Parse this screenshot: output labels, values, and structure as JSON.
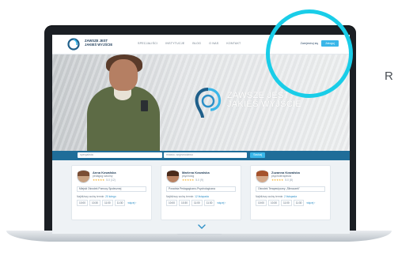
{
  "brand": {
    "name_line1": "ZAWSZE JEST",
    "name_line2": "JAKIEŚ WYJŚCIE",
    "accent": "#3ab6e8",
    "dark": "#1f6d99"
  },
  "nav": {
    "items": [
      "SPECJALIŚCI",
      "INSTYTUCJE",
      "BLOG",
      "O NAS",
      "KONTAKT"
    ],
    "login": "Zarejestruj się",
    "cta": "Zaloguj"
  },
  "hero": {
    "line1": "ZAWSZE JEST",
    "line2": "JAKIEŚ WYJŚCIE"
  },
  "search": {
    "specialist_placeholder": "specjalista",
    "location_placeholder": "miasto, województwo",
    "button": "Szukaj"
  },
  "cards": [
    {
      "name": "Anna Kowalska",
      "role": "pedagog szkolny",
      "stars": "★★★★★",
      "score": "5.0 (12)",
      "tag": "Miejski Ośrodek Pomocy Społecznej",
      "next_label": "Najbliższy wolny termin:",
      "next_date": "20 lutego",
      "slots": [
        "10:00",
        "10:30",
        "11:00",
        "11:30"
      ],
      "more": "więcej ›"
    },
    {
      "name": "Marlena Kowalska",
      "role": "psycholog",
      "stars": "★★★★★",
      "score": "5.0 (9)",
      "tag": "Poradnia Pedagogiczno-Psychologiczna",
      "next_label": "Najbliższy wolny termin:",
      "next_date": "12 listopada",
      "slots": [
        "10:00",
        "10:30",
        "11:00",
        "11:30"
      ],
      "more": "więcej ›"
    },
    {
      "name": "Zuzanna Kowalska",
      "role": "psychoterapeuta",
      "stars": "★★★★★",
      "score": "5.0 (8)",
      "tag": "Ośrodek Terapeutyczny „Ślimaczek”",
      "next_label": "Najbliższy wolny termin:",
      "next_date": "2 listopada",
      "slots": [
        "10:00",
        "10:30",
        "11:00",
        "11:30"
      ],
      "more": "więcej ›"
    }
  ],
  "overlay": {
    "ring_color": "#19cde8",
    "side_letter": "R"
  }
}
